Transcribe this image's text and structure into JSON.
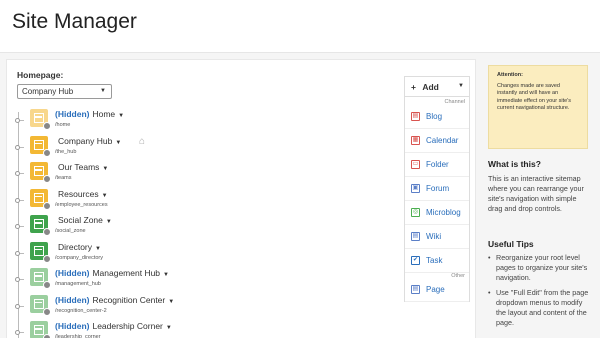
{
  "page": {
    "title": "Site Manager"
  },
  "homepage": {
    "label": "Homepage:",
    "selected": "Company Hub"
  },
  "tree": [
    {
      "hidden_tag": "(Hidden)",
      "title": "Home",
      "path": "/home",
      "icon": "yellow-light"
    },
    {
      "hidden_tag": "",
      "title": "Company Hub",
      "path": "/the_hub",
      "icon": "yellow",
      "is_homepage": true
    },
    {
      "hidden_tag": "",
      "title": "Our Teams",
      "path": "/teams",
      "icon": "yellow"
    },
    {
      "hidden_tag": "",
      "title": "Resources",
      "path": "/employee_resources",
      "icon": "yellow"
    },
    {
      "hidden_tag": "",
      "title": "Social Zone",
      "path": "/social_zone",
      "icon": "green"
    },
    {
      "hidden_tag": "",
      "title": "Directory",
      "path": "/company_directory",
      "icon": "green"
    },
    {
      "hidden_tag": "(Hidden)",
      "title": "Management Hub",
      "path": "/management_hub",
      "icon": "green-light"
    },
    {
      "hidden_tag": "(Hidden)",
      "title": "Recognition Center",
      "path": "/recognition_center-2",
      "icon": "green-light"
    },
    {
      "hidden_tag": "(Hidden)",
      "title": "Leadership Corner",
      "path": "/leadership_corner",
      "icon": "green-light"
    }
  ],
  "palette": {
    "add_label": "Add",
    "channel_label": "Channel",
    "channel_items": [
      {
        "label": "Blog",
        "icon": "blog-icon"
      },
      {
        "label": "Calendar",
        "icon": "calendar-icon"
      },
      {
        "label": "Folder",
        "icon": "folder-icon"
      },
      {
        "label": "Forum",
        "icon": "forum-icon"
      },
      {
        "label": "Microblog",
        "icon": "microblog-icon"
      },
      {
        "label": "Wiki",
        "icon": "wiki-icon"
      },
      {
        "label": "Task",
        "icon": "task-icon"
      }
    ],
    "other_label": "Other",
    "other_items": [
      {
        "label": "Page",
        "icon": "page-icon"
      }
    ]
  },
  "sidebar": {
    "attention_title": "Attention:",
    "attention_text": "Changes made are saved instantly and will have an immediate effect on your site's current navigational structure.",
    "what_title": "What is this?",
    "what_text": "This is an interactive sitemap where you can rearrange your site's navigation with simple drag and drop controls.",
    "tips_title": "Useful Tips",
    "tips": [
      "Reorganize your root level pages to organize your site's navigation.",
      "Use \"Full Edit\" from the page dropdown menus to modify the layout and content of the page."
    ]
  },
  "colors": {
    "accent": "#2a6ebb",
    "yellow": "#f3b834",
    "green": "#3fa34d",
    "attention_bg": "#fbedbf"
  }
}
